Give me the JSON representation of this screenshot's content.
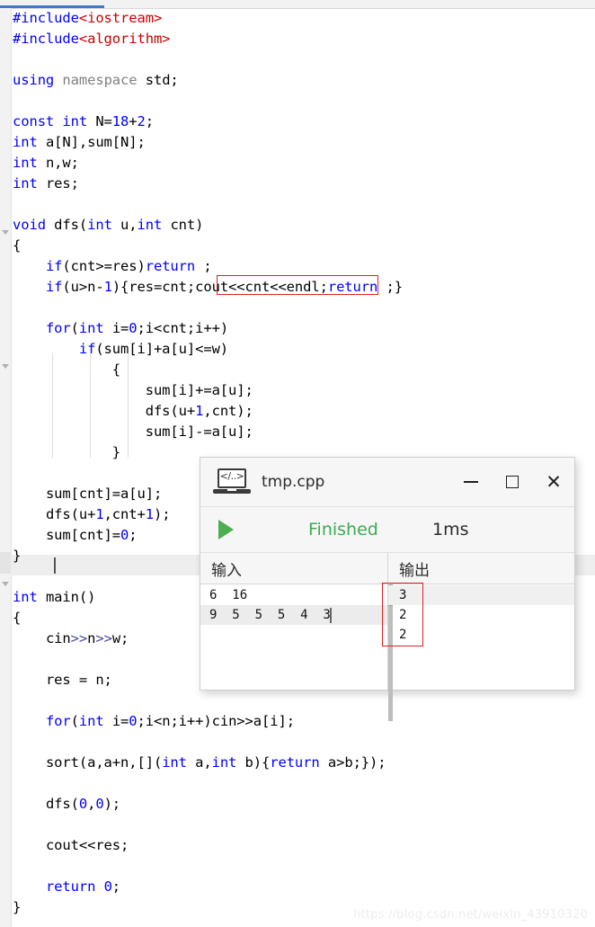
{
  "editor": {
    "tab_label": "",
    "code_lines": [
      {
        "indent": 0,
        "tokens": [
          {
            "t": "#include",
            "c": "pre"
          },
          {
            "t": "<iostream>",
            "c": "str"
          }
        ]
      },
      {
        "indent": 0,
        "tokens": [
          {
            "t": "#include",
            "c": "pre"
          },
          {
            "t": "<algorithm>",
            "c": "str"
          }
        ]
      },
      {
        "indent": 0,
        "tokens": []
      },
      {
        "indent": 0,
        "tokens": [
          {
            "t": "using ",
            "c": "kw"
          },
          {
            "t": "namespace ",
            "c": "ns"
          },
          {
            "t": "std;",
            "c": "pln"
          }
        ]
      },
      {
        "indent": 0,
        "tokens": []
      },
      {
        "indent": 0,
        "tokens": [
          {
            "t": "const int ",
            "c": "kw"
          },
          {
            "t": "N=",
            "c": "pln"
          },
          {
            "t": "18",
            "c": "num"
          },
          {
            "t": "+",
            "c": "pln"
          },
          {
            "t": "2",
            "c": "num"
          },
          {
            "t": ";",
            "c": "pln"
          }
        ]
      },
      {
        "indent": 0,
        "tokens": [
          {
            "t": "int ",
            "c": "kw"
          },
          {
            "t": "a[N],sum[N];",
            "c": "pln"
          }
        ]
      },
      {
        "indent": 0,
        "tokens": [
          {
            "t": "int ",
            "c": "kw"
          },
          {
            "t": "n,w;",
            "c": "pln"
          }
        ]
      },
      {
        "indent": 0,
        "tokens": [
          {
            "t": "int ",
            "c": "kw"
          },
          {
            "t": "res;",
            "c": "pln"
          }
        ]
      },
      {
        "indent": 0,
        "tokens": []
      },
      {
        "indent": 0,
        "tokens": [
          {
            "t": "void ",
            "c": "kw"
          },
          {
            "t": "dfs(",
            "c": "pln"
          },
          {
            "t": "int ",
            "c": "kw"
          },
          {
            "t": "u,",
            "c": "pln"
          },
          {
            "t": "int ",
            "c": "kw"
          },
          {
            "t": "cnt)",
            "c": "pln"
          }
        ]
      },
      {
        "indent": 0,
        "tokens": [
          {
            "t": "{",
            "c": "pln"
          }
        ]
      },
      {
        "indent": 1,
        "tokens": [
          {
            "t": "if",
            "c": "kw"
          },
          {
            "t": "(cnt>=res)",
            "c": "pln"
          },
          {
            "t": "return",
            "c": "kw"
          },
          {
            "t": " ;",
            "c": "pln"
          }
        ]
      },
      {
        "indent": 1,
        "tokens": [
          {
            "t": "if",
            "c": "kw"
          },
          {
            "t": "(u>n-",
            "c": "pln"
          },
          {
            "t": "1",
            "c": "num"
          },
          {
            "t": "){res=cnt;cout<<cnt<<endl;",
            "c": "pln"
          },
          {
            "t": "return",
            "c": "kw"
          },
          {
            "t": " ;}",
            "c": "pln"
          }
        ]
      },
      {
        "indent": 0,
        "tokens": []
      },
      {
        "indent": 1,
        "tokens": [
          {
            "t": "for",
            "c": "kw"
          },
          {
            "t": "(",
            "c": "pln"
          },
          {
            "t": "int ",
            "c": "kw"
          },
          {
            "t": "i=",
            "c": "pln"
          },
          {
            "t": "0",
            "c": "num"
          },
          {
            "t": ";i<cnt;i++)",
            "c": "pln"
          }
        ]
      },
      {
        "indent": 2,
        "tokens": [
          {
            "t": "if",
            "c": "kw"
          },
          {
            "t": "(sum[i]+a[u]<=w)",
            "c": "pln"
          }
        ]
      },
      {
        "indent": 3,
        "tokens": [
          {
            "t": "{",
            "c": "pln"
          }
        ]
      },
      {
        "indent": 4,
        "tokens": [
          {
            "t": "sum[i]+=a[u];",
            "c": "pln"
          }
        ]
      },
      {
        "indent": 4,
        "tokens": [
          {
            "t": "dfs(u+",
            "c": "pln"
          },
          {
            "t": "1",
            "c": "num"
          },
          {
            "t": ",cnt);",
            "c": "pln"
          }
        ]
      },
      {
        "indent": 4,
        "tokens": [
          {
            "t": "sum[i]-=a[u];",
            "c": "pln"
          }
        ]
      },
      {
        "indent": 3,
        "tokens": [
          {
            "t": "}",
            "c": "pln"
          }
        ]
      },
      {
        "indent": 0,
        "tokens": []
      },
      {
        "indent": 1,
        "tokens": [
          {
            "t": "sum[cnt]=a[u];",
            "c": "pln"
          }
        ]
      },
      {
        "indent": 1,
        "tokens": [
          {
            "t": "dfs(u+",
            "c": "pln"
          },
          {
            "t": "1",
            "c": "num"
          },
          {
            "t": ",cnt+",
            "c": "pln"
          },
          {
            "t": "1",
            "c": "num"
          },
          {
            "t": ");",
            "c": "pln"
          }
        ]
      },
      {
        "indent": 1,
        "tokens": [
          {
            "t": "sum[cnt]=",
            "c": "pln"
          },
          {
            "t": "0",
            "c": "num"
          },
          {
            "t": ";",
            "c": "pln"
          }
        ]
      },
      {
        "indent": 0,
        "tokens": [
          {
            "t": "}",
            "c": "pln"
          }
        ]
      },
      {
        "indent": 0,
        "tokens": []
      },
      {
        "indent": 0,
        "tokens": [
          {
            "t": "int ",
            "c": "kw"
          },
          {
            "t": "main()",
            "c": "pln"
          }
        ]
      },
      {
        "indent": 0,
        "tokens": [
          {
            "t": "{",
            "c": "pln"
          }
        ]
      },
      {
        "indent": 1,
        "tokens": [
          {
            "t": "cin",
            "c": "pln"
          },
          {
            "t": ">>",
            "c": "op"
          },
          {
            "t": "n",
            "c": "pln"
          },
          {
            "t": ">>",
            "c": "op"
          },
          {
            "t": "w;",
            "c": "pln"
          }
        ]
      },
      {
        "indent": 0,
        "tokens": []
      },
      {
        "indent": 1,
        "tokens": [
          {
            "t": "res = n;",
            "c": "pln"
          }
        ]
      },
      {
        "indent": 0,
        "tokens": []
      },
      {
        "indent": 1,
        "tokens": [
          {
            "t": "for",
            "c": "kw"
          },
          {
            "t": "(",
            "c": "pln"
          },
          {
            "t": "int ",
            "c": "kw"
          },
          {
            "t": "i=",
            "c": "pln"
          },
          {
            "t": "0",
            "c": "num"
          },
          {
            "t": ";i<n;i++)cin>>a[i];",
            "c": "pln"
          }
        ]
      },
      {
        "indent": 0,
        "tokens": []
      },
      {
        "indent": 1,
        "tokens": [
          {
            "t": "sort(a,a+n,[](",
            "c": "pln"
          },
          {
            "t": "int ",
            "c": "kw"
          },
          {
            "t": "a,",
            "c": "pln"
          },
          {
            "t": "int ",
            "c": "kw"
          },
          {
            "t": "b){",
            "c": "pln"
          },
          {
            "t": "return",
            "c": "kw"
          },
          {
            "t": " a>b;});",
            "c": "pln"
          }
        ]
      },
      {
        "indent": 0,
        "tokens": []
      },
      {
        "indent": 1,
        "tokens": [
          {
            "t": "dfs(",
            "c": "pln"
          },
          {
            "t": "0",
            "c": "num"
          },
          {
            "t": ",",
            "c": "pln"
          },
          {
            "t": "0",
            "c": "num"
          },
          {
            "t": ");",
            "c": "pln"
          }
        ]
      },
      {
        "indent": 0,
        "tokens": []
      },
      {
        "indent": 1,
        "tokens": [
          {
            "t": "cout<<res;",
            "c": "pln"
          }
        ]
      },
      {
        "indent": 0,
        "tokens": []
      },
      {
        "indent": 1,
        "tokens": [
          {
            "t": "return ",
            "c": "kw"
          },
          {
            "t": "0",
            "c": "num"
          },
          {
            "t": ";",
            "c": "pln"
          }
        ]
      },
      {
        "indent": 0,
        "tokens": [
          {
            "t": "}",
            "c": "pln"
          }
        ]
      }
    ],
    "watermark": "https://blog.csdn.net/weixin_43910320"
  },
  "run_window": {
    "title": "tmp.cpp",
    "icon": "laptop-code-icon",
    "code_glyph": "</..>",
    "buttons": {
      "minimize": "—",
      "maximize": "□",
      "close": "✕"
    },
    "status": {
      "run_icon": "play-icon",
      "label": "Finished",
      "time": "1ms",
      "label_color": "#3cab54"
    },
    "input_pane": {
      "header": "输入",
      "lines": [
        "6  16",
        "9  5  5  5  4  3"
      ]
    },
    "output_pane": {
      "header": "输出",
      "lines": [
        "3",
        "2",
        "2"
      ]
    }
  },
  "annotations": {
    "box_color": "#e02020",
    "code_highlight_text": "cout<<cnt<<endl;",
    "output_highlight_values": [
      "3",
      "2",
      "2"
    ]
  }
}
